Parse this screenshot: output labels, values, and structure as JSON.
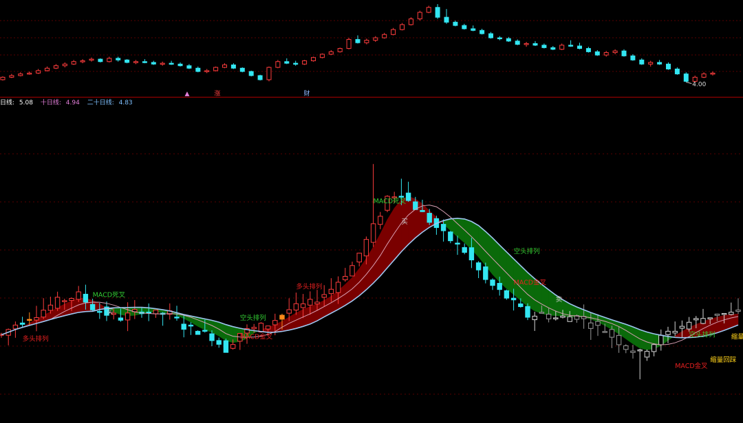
{
  "colors": {
    "background": "#000000",
    "up": "#ff3d3d",
    "down": "#33e6f2",
    "grid": "#5a0000",
    "separator": "#aa0000",
    "ma20": "#9ec6f0",
    "ma10": "#d9a0b4",
    "bull_fill": "#7a0000",
    "bear_fill": "#0a6a0a",
    "signal_red": "#e62020",
    "signal_green": "#33cc33",
    "signal_yellow": "#ffd21a"
  },
  "legend": {
    "ma5_label": "日线:",
    "ma5_value": "5.08",
    "ma10_label": "十日线:",
    "ma10_value": "4.94",
    "ma20_label": "二十日线:",
    "ma20_value": "4.83",
    "ma5_color": "#ffffff",
    "ma10_color": "#e27fd9",
    "ma20_color": "#7fc0ff"
  },
  "overview": {
    "low_label": "4.00",
    "markers": [
      {
        "text": "▲",
        "x": 272,
        "color": "#e27fd9"
      },
      {
        "text": "涨",
        "x": 316,
        "color": "#ff4040"
      },
      {
        "text": "财",
        "x": 446,
        "color": "#8fb8ff"
      }
    ]
  },
  "chart_data": [
    {
      "type": "candlestick",
      "name": "overview",
      "title": "",
      "bars": 81,
      "ohlc": [
        [
          1.0,
          1.4,
          0.9,
          1.3
        ],
        [
          1.3,
          1.7,
          1.2,
          1.5
        ],
        [
          1.5,
          1.9,
          1.4,
          1.7
        ],
        [
          1.7,
          2.0,
          1.6,
          1.8
        ],
        [
          1.8,
          2.3,
          1.7,
          2.1
        ],
        [
          2.1,
          2.6,
          2.0,
          2.4
        ],
        [
          2.4,
          2.9,
          2.3,
          2.7
        ],
        [
          2.7,
          3.1,
          2.5,
          2.9
        ],
        [
          2.9,
          3.4,
          2.8,
          3.2
        ],
        [
          3.2,
          3.5,
          3.0,
          3.3
        ],
        [
          3.4,
          3.7,
          3.2,
          3.5
        ],
        [
          3.5,
          3.6,
          3.1,
          3.2
        ],
        [
          3.2,
          3.8,
          3.1,
          3.6
        ],
        [
          3.6,
          3.8,
          3.2,
          3.4
        ],
        [
          3.4,
          3.5,
          3.0,
          3.1
        ],
        [
          3.1,
          3.4,
          2.9,
          3.2
        ],
        [
          3.2,
          3.5,
          3.0,
          3.1
        ],
        [
          3.1,
          3.3,
          2.8,
          2.9
        ],
        [
          2.9,
          3.2,
          2.7,
          3.0
        ],
        [
          3.0,
          3.3,
          2.8,
          2.9
        ],
        [
          2.9,
          3.1,
          2.6,
          2.7
        ],
        [
          2.7,
          2.9,
          2.3,
          2.4
        ],
        [
          2.4,
          2.6,
          1.9,
          2.0
        ],
        [
          2.0,
          2.3,
          1.8,
          2.1
        ],
        [
          2.1,
          2.6,
          2.0,
          2.5
        ],
        [
          2.5,
          3.0,
          2.4,
          2.8
        ],
        [
          2.8,
          3.0,
          2.3,
          2.4
        ],
        [
          2.4,
          2.5,
          1.9,
          2.0
        ],
        [
          2.0,
          2.1,
          1.4,
          1.5
        ],
        [
          1.5,
          1.6,
          0.9,
          1.0
        ],
        [
          1.0,
          2.6,
          0.8,
          2.5
        ],
        [
          2.5,
          3.4,
          2.4,
          3.2
        ],
        [
          3.2,
          3.6,
          2.9,
          3.0
        ],
        [
          3.0,
          3.3,
          2.7,
          2.9
        ],
        [
          2.9,
          3.4,
          2.8,
          3.3
        ],
        [
          3.3,
          3.8,
          3.2,
          3.7
        ],
        [
          3.7,
          4.2,
          3.6,
          4.1
        ],
        [
          4.1,
          4.6,
          4.0,
          4.4
        ],
        [
          4.4,
          4.9,
          4.3,
          4.8
        ],
        [
          4.8,
          6.1,
          4.7,
          5.9
        ],
        [
          5.9,
          6.4,
          5.4,
          5.5
        ],
        [
          5.5,
          6.0,
          5.3,
          5.8
        ],
        [
          5.8,
          6.3,
          5.6,
          6.1
        ],
        [
          6.1,
          6.7,
          6.0,
          6.5
        ],
        [
          6.5,
          7.3,
          6.4,
          7.1
        ],
        [
          7.1,
          7.9,
          7.0,
          7.7
        ],
        [
          7.7,
          8.6,
          7.6,
          8.4
        ],
        [
          8.4,
          9.4,
          8.2,
          9.2
        ],
        [
          9.2,
          10.0,
          9.1,
          9.8
        ],
        [
          9.8,
          10.2,
          8.4,
          8.6
        ],
        [
          8.6,
          9.6,
          7.8,
          8.0
        ],
        [
          8.0,
          8.2,
          7.5,
          7.6
        ],
        [
          7.6,
          7.8,
          7.1,
          7.2
        ],
        [
          7.2,
          7.6,
          6.9,
          7.0
        ],
        [
          7.0,
          7.2,
          6.5,
          6.6
        ],
        [
          6.6,
          6.8,
          6.0,
          6.1
        ],
        [
          6.1,
          6.3,
          5.8,
          6.0
        ],
        [
          6.0,
          6.2,
          5.6,
          5.7
        ],
        [
          5.7,
          5.9,
          5.2,
          5.3
        ],
        [
          5.3,
          5.6,
          5.0,
          5.4
        ],
        [
          5.4,
          5.7,
          5.1,
          5.2
        ],
        [
          5.2,
          5.4,
          4.8,
          4.9
        ],
        [
          4.9,
          5.1,
          4.6,
          4.7
        ],
        [
          4.7,
          5.4,
          4.6,
          5.2
        ],
        [
          5.2,
          5.8,
          5.0,
          5.1
        ],
        [
          5.1,
          5.5,
          4.7,
          4.8
        ],
        [
          4.8,
          5.0,
          4.3,
          4.4
        ],
        [
          4.4,
          4.6,
          3.9,
          4.0
        ],
        [
          4.0,
          4.5,
          3.8,
          4.3
        ],
        [
          4.3,
          4.7,
          4.1,
          4.5
        ],
        [
          4.5,
          4.7,
          3.8,
          3.9
        ],
        [
          3.9,
          4.1,
          3.3,
          3.4
        ],
        [
          3.4,
          3.6,
          2.8,
          2.9
        ],
        [
          2.9,
          3.3,
          2.6,
          3.1
        ],
        [
          3.1,
          3.4,
          2.8,
          2.9
        ],
        [
          2.9,
          3.1,
          2.2,
          2.3
        ],
        [
          2.3,
          2.5,
          1.6,
          1.7
        ],
        [
          1.7,
          1.9,
          0.7,
          0.8
        ],
        [
          0.8,
          1.5,
          0.6,
          1.3
        ],
        [
          1.3,
          1.9,
          1.2,
          1.7
        ],
        [
          1.7,
          2.0,
          1.5,
          1.8
        ]
      ]
    },
    {
      "type": "candlestick",
      "name": "main",
      "title": "",
      "series": [
        {
          "name": "日线",
          "value": 5.08
        },
        {
          "name": "十日线",
          "value": 4.94
        },
        {
          "name": "二十日线",
          "value": 4.83
        }
      ],
      "close_profile": [
        [
          0,
          1.0
        ],
        [
          2,
          2.0
        ],
        [
          5,
          3.0
        ],
        [
          8,
          4.2
        ],
        [
          11,
          4.8
        ],
        [
          13,
          3.6
        ],
        [
          15,
          3.0
        ],
        [
          17,
          2.6
        ],
        [
          20,
          3.4
        ],
        [
          22,
          3.0
        ],
        [
          24,
          3.0
        ],
        [
          26,
          1.8
        ],
        [
          28,
          1.4
        ],
        [
          30,
          0.8
        ],
        [
          32,
          -0.4
        ],
        [
          34,
          1.2
        ],
        [
          35,
          1.4
        ],
        [
          38,
          2.0
        ],
        [
          41,
          3.4
        ],
        [
          44,
          4.0
        ],
        [
          47,
          5.4
        ],
        [
          50,
          7.6
        ],
        [
          52,
          10.0
        ],
        [
          54,
          12.6
        ],
        [
          55,
          14.2
        ],
        [
          57,
          14.6
        ],
        [
          58,
          13.8
        ],
        [
          60,
          12.6
        ],
        [
          63,
          10.6
        ],
        [
          66,
          9.0
        ],
        [
          69,
          6.2
        ],
        [
          72,
          4.6
        ],
        [
          75,
          2.8
        ],
        [
          77,
          3.0
        ],
        [
          79,
          2.6
        ],
        [
          82,
          2.8
        ],
        [
          84,
          2.0
        ],
        [
          86,
          1.4
        ],
        [
          89,
          -0.2
        ],
        [
          91,
          -0.8
        ],
        [
          93,
          0.2
        ],
        [
          95,
          1.2
        ],
        [
          98,
          2.2
        ],
        [
          100,
          2.6
        ],
        [
          102,
          3.0
        ]
      ]
    }
  ],
  "annotations": [
    {
      "text": "多头排列",
      "color": "#e62020",
      "bar": 3,
      "price": 0.4
    },
    {
      "text": "MACD死叉",
      "color": "#33cc33",
      "bar": 13,
      "price": 4.6
    },
    {
      "text": "空头排列",
      "color": "#33cc33",
      "bar": 34,
      "price": 2.4
    },
    {
      "text": "MACD金叉",
      "color": "#e62020",
      "bar": 34,
      "price": 0.6
    },
    {
      "text": "多头排列",
      "color": "#e62020",
      "bar": 42,
      "price": 5.4
    },
    {
      "text": "MACD死叉",
      "color": "#33cc33",
      "bar": 53,
      "price": 13.6
    },
    {
      "text": "空头排列",
      "color": "#33cc33",
      "bar": 73,
      "price": 8.8
    },
    {
      "text": "MACD金叉",
      "color": "#e62020",
      "bar": 73,
      "price": 5.8
    },
    {
      "text": "空头排列",
      "color": "#33cc33",
      "bar": 98,
      "price": 0.8
    },
    {
      "text": "缩量回踩",
      "color": "#ffd21a",
      "bar": 104,
      "price": 0.6
    },
    {
      "text": "缩量回踩",
      "color": "#ffd21a",
      "bar": 101,
      "price": -1.6
    },
    {
      "text": "MACD金叉",
      "color": "#e62020",
      "bar": 96,
      "price": -2.2
    },
    {
      "text": "买",
      "color": "#cccccc",
      "bar": 57,
      "price": 11.6
    },
    {
      "text": "买",
      "color": "#cccccc",
      "bar": 15,
      "price": 3.0
    },
    {
      "text": "卖",
      "color": "#cccccc",
      "bar": 79,
      "price": 4.2
    }
  ]
}
